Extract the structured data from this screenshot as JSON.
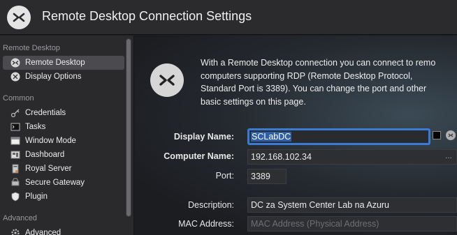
{
  "window": {
    "title": "Remote Desktop Connection Settings",
    "icon": "remote-desktop-icon"
  },
  "sidebar": {
    "sections": [
      {
        "label": "Remote Desktop",
        "items": [
          {
            "label": "Remote Desktop",
            "icon": "remote-desktop-icon",
            "selected": true
          },
          {
            "label": "Display Options",
            "icon": "display-options-icon"
          }
        ]
      },
      {
        "label": "Common",
        "items": [
          {
            "label": "Credentials",
            "icon": "key-icon"
          },
          {
            "label": "Tasks",
            "icon": "terminal-icon"
          },
          {
            "label": "Window Mode",
            "icon": "window-icon"
          },
          {
            "label": "Dashboard",
            "icon": "dashboard-icon"
          },
          {
            "label": "Royal Server",
            "icon": "server-icon"
          },
          {
            "label": "Secure Gateway",
            "icon": "gateway-icon"
          },
          {
            "label": "Plugin",
            "icon": "shield-icon"
          }
        ]
      },
      {
        "label": "Advanced",
        "items": [
          {
            "label": "Advanced",
            "icon": "gear-icon"
          }
        ]
      }
    ]
  },
  "main": {
    "intro_lines": [
      "With a Remote Desktop connection you can connect to remo",
      "computers supporting RDP (Remote Desktop Protocol,",
      "Standard Port is 3389). You can change the port and other",
      "basic settings on this page."
    ],
    "fields": {
      "display_name": {
        "label": "Display Name:",
        "value": "SCLabDC"
      },
      "computer_name": {
        "label": "Computer Name:",
        "value": "192.168.102.34",
        "button": "..."
      },
      "port": {
        "label": "Port:",
        "value": "3389"
      },
      "description": {
        "label": "Description:",
        "value": "DC za System Center Lab na Azuru"
      },
      "mac_address": {
        "label": "MAC Address:",
        "placeholder": "MAC Address (Physical Address)"
      }
    },
    "display_color": "#000000"
  }
}
